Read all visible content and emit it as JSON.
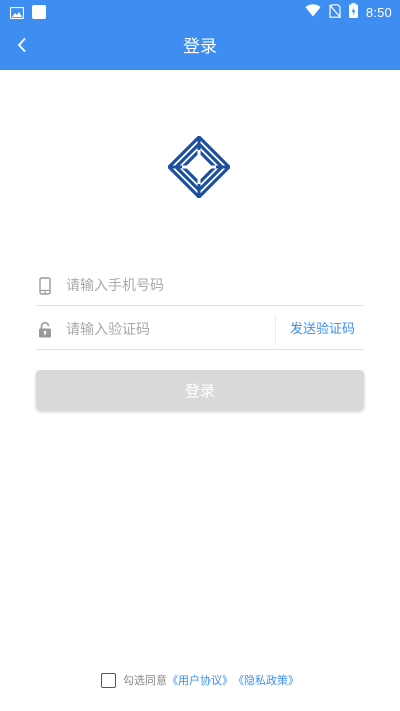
{
  "status_bar": {
    "time": "8:50",
    "icons": [
      "image-icon",
      "square-icon",
      "wifi-icon",
      "no-sim-icon",
      "battery-icon"
    ]
  },
  "app_bar": {
    "title": "登录",
    "back_icon": "chevron-left-icon"
  },
  "logo": {
    "name": "logo-emblem",
    "color": "#1d4fa0"
  },
  "form": {
    "phone_placeholder": "请输入手机号码",
    "phone_value": "",
    "code_placeholder": "请输入验证码",
    "code_value": "",
    "send_code_label": "发送验证码",
    "login_label": "登录"
  },
  "agreement": {
    "prefix": "勾选同意",
    "user_agreement": "《用户协议》",
    "privacy_policy": "《隐私政策》",
    "checked": false
  },
  "colors": {
    "primary": "#3d8ef0",
    "logo": "#1d4fa0",
    "button_disabled": "#d9d9d9",
    "placeholder": "#a9a9a9"
  }
}
